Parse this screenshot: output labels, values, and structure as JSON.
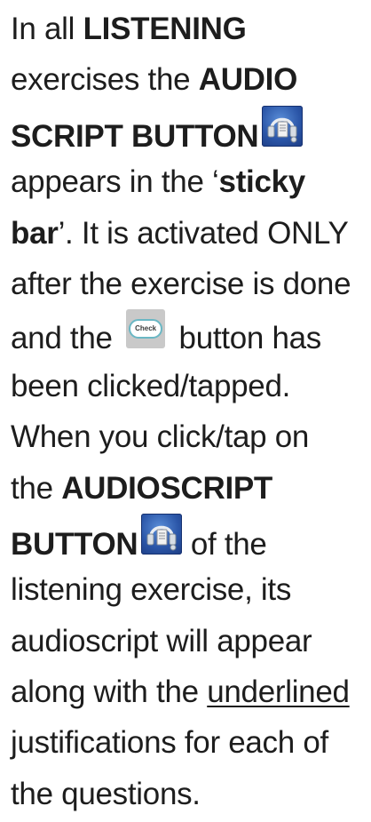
{
  "lines": [
    [
      {
        "t": "In all "
      },
      {
        "t": "LISTENING",
        "s": "b"
      }
    ],
    [
      {
        "t": "exercises the "
      },
      {
        "t": "AUDIO",
        "s": "b"
      }
    ],
    [
      {
        "t": "SCRIPT BUTTON",
        "s": "b"
      },
      {
        "icon": "audio-script-icon"
      }
    ],
    [
      {
        "t": "appears in the ‘"
      },
      {
        "t": "sticky",
        "s": "b"
      }
    ],
    [
      {
        "t": "bar",
        "s": "b"
      },
      {
        "t": "’. It is activated ONLY"
      }
    ],
    [
      {
        "t": "after the exercise is done"
      }
    ],
    [
      {
        "t": "and the "
      },
      {
        "icon": "check-button-icon"
      },
      {
        "t": " button has"
      }
    ],
    [
      {
        "t": "been clicked/tapped."
      }
    ],
    [
      {
        "t": "When you click/tap on"
      }
    ],
    [
      {
        "t": "the "
      },
      {
        "t": "AUDIOSCRIPT",
        "s": "b"
      }
    ],
    [
      {
        "t": "BUTTON",
        "s": "b"
      },
      {
        "icon": "audio-script-icon"
      },
      {
        "t": " of the"
      }
    ],
    [
      {
        "t": "listening exercise, its"
      }
    ],
    [
      {
        "t": "audioscript will appear"
      }
    ],
    [
      {
        "t": "along with the "
      },
      {
        "t": "underlined",
        "s": "u"
      }
    ],
    [
      {
        "t": "justifications for each of"
      }
    ],
    [
      {
        "t": "the questions."
      }
    ]
  ],
  "check_button": {
    "label": "Check"
  },
  "colors": {
    "text": "#1d1d1d",
    "audio_icon_bg": "#2b56a8",
    "check_bg": "#c9c9c9",
    "check_border": "#6ab7c4"
  }
}
